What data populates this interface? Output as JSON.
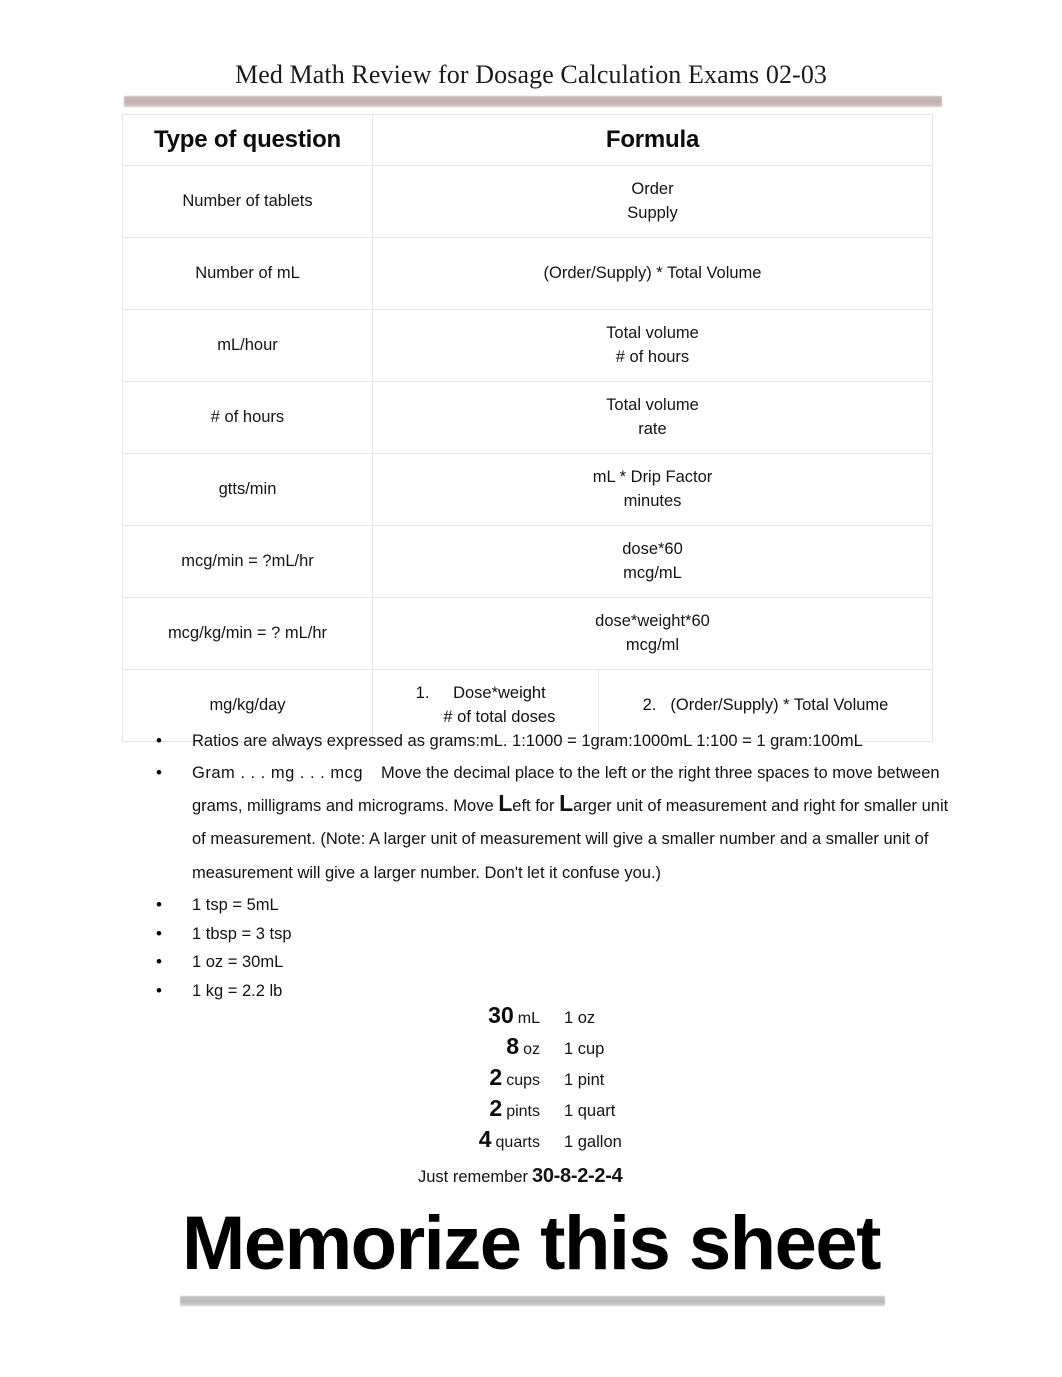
{
  "document": {
    "title": "Med Math Review for Dosage Calculation Exams 02-03"
  },
  "formula_table": {
    "headers": {
      "type": "Type of question",
      "formula": "Formula"
    },
    "rows": [
      {
        "type": "Number of tablets",
        "formula_top": "Order",
        "formula_bottom": "Supply"
      },
      {
        "type": "Number of mL",
        "formula_single": "(Order/Supply) * Total Volume"
      },
      {
        "type": "mL/hour",
        "formula_top": "Total volume",
        "formula_bottom": "# of hours"
      },
      {
        "type": "# of hours",
        "formula_top": "Total volume",
        "formula_bottom": "rate"
      },
      {
        "type": "gtts/min",
        "formula_top": "mL * Drip Factor",
        "formula_bottom": "minutes"
      },
      {
        "type": "mcg/min = ?mL/hr",
        "formula_top": "dose*60",
        "formula_bottom": "mcg/mL"
      },
      {
        "type": "mcg/kg/min = ? mL/hr",
        "formula_top": "dose*weight*60",
        "formula_bottom": "mcg/ml"
      }
    ],
    "last_row": {
      "type": "mg/kg/day",
      "option_1_marker": "1.",
      "option_1_top": "Dose*weight",
      "option_1_bottom": "# of total doses",
      "option_2_marker": "2.",
      "option_2_text": "(Order/Supply) * Total Volume"
    }
  },
  "notes": {
    "bullet_1": "Ratios are always expressed as grams:mL. 1:1000 = 1gram:1000mL 1:100 = 1 gram:100mL",
    "bullet_2": {
      "lead": "Gram . . . mg . . . mcg",
      "part_1": "Move the decimal place to the left or the right three spaces to move between grams, milligrams and micrograms. Move ",
      "big_l_1": "L",
      "part_2": "eft for ",
      "big_l_2": "L",
      "part_3": "arger unit of measurement and right for smaller unit of measurement. (Note: A larger unit of measurement will give a smaller number and a smaller unit of measurement will give a larger number. Don't let it confuse you.)"
    },
    "bullet_3": "1 tsp = 5mL",
    "bullet_4": "1 tbsp = 3 tsp",
    "bullet_5": "1 oz = 30mL",
    "bullet_6": "1 kg = 2.2 lb"
  },
  "conversions": {
    "rows": [
      {
        "amount": "30",
        "unit": "mL",
        "equals": "1 oz"
      },
      {
        "amount": "8",
        "unit": "oz",
        "equals": "1 cup"
      },
      {
        "amount": "2",
        "unit": "cups",
        "equals": "1 pint"
      },
      {
        "amount": "2",
        "unit": "pints",
        "equals": "1 quart"
      },
      {
        "amount": "4",
        "unit": "quarts",
        "equals": "1 gallon"
      }
    ],
    "remember_label": "Just remember",
    "remember_value": "30-8-2-2-4"
  },
  "footer": {
    "memorize": "Memorize this sheet"
  },
  "colors": {
    "top_bar": "#c2b0ae",
    "bottom_bar": "#b9b9b9",
    "table_border": "#e6e6e6",
    "text": "#111111"
  }
}
